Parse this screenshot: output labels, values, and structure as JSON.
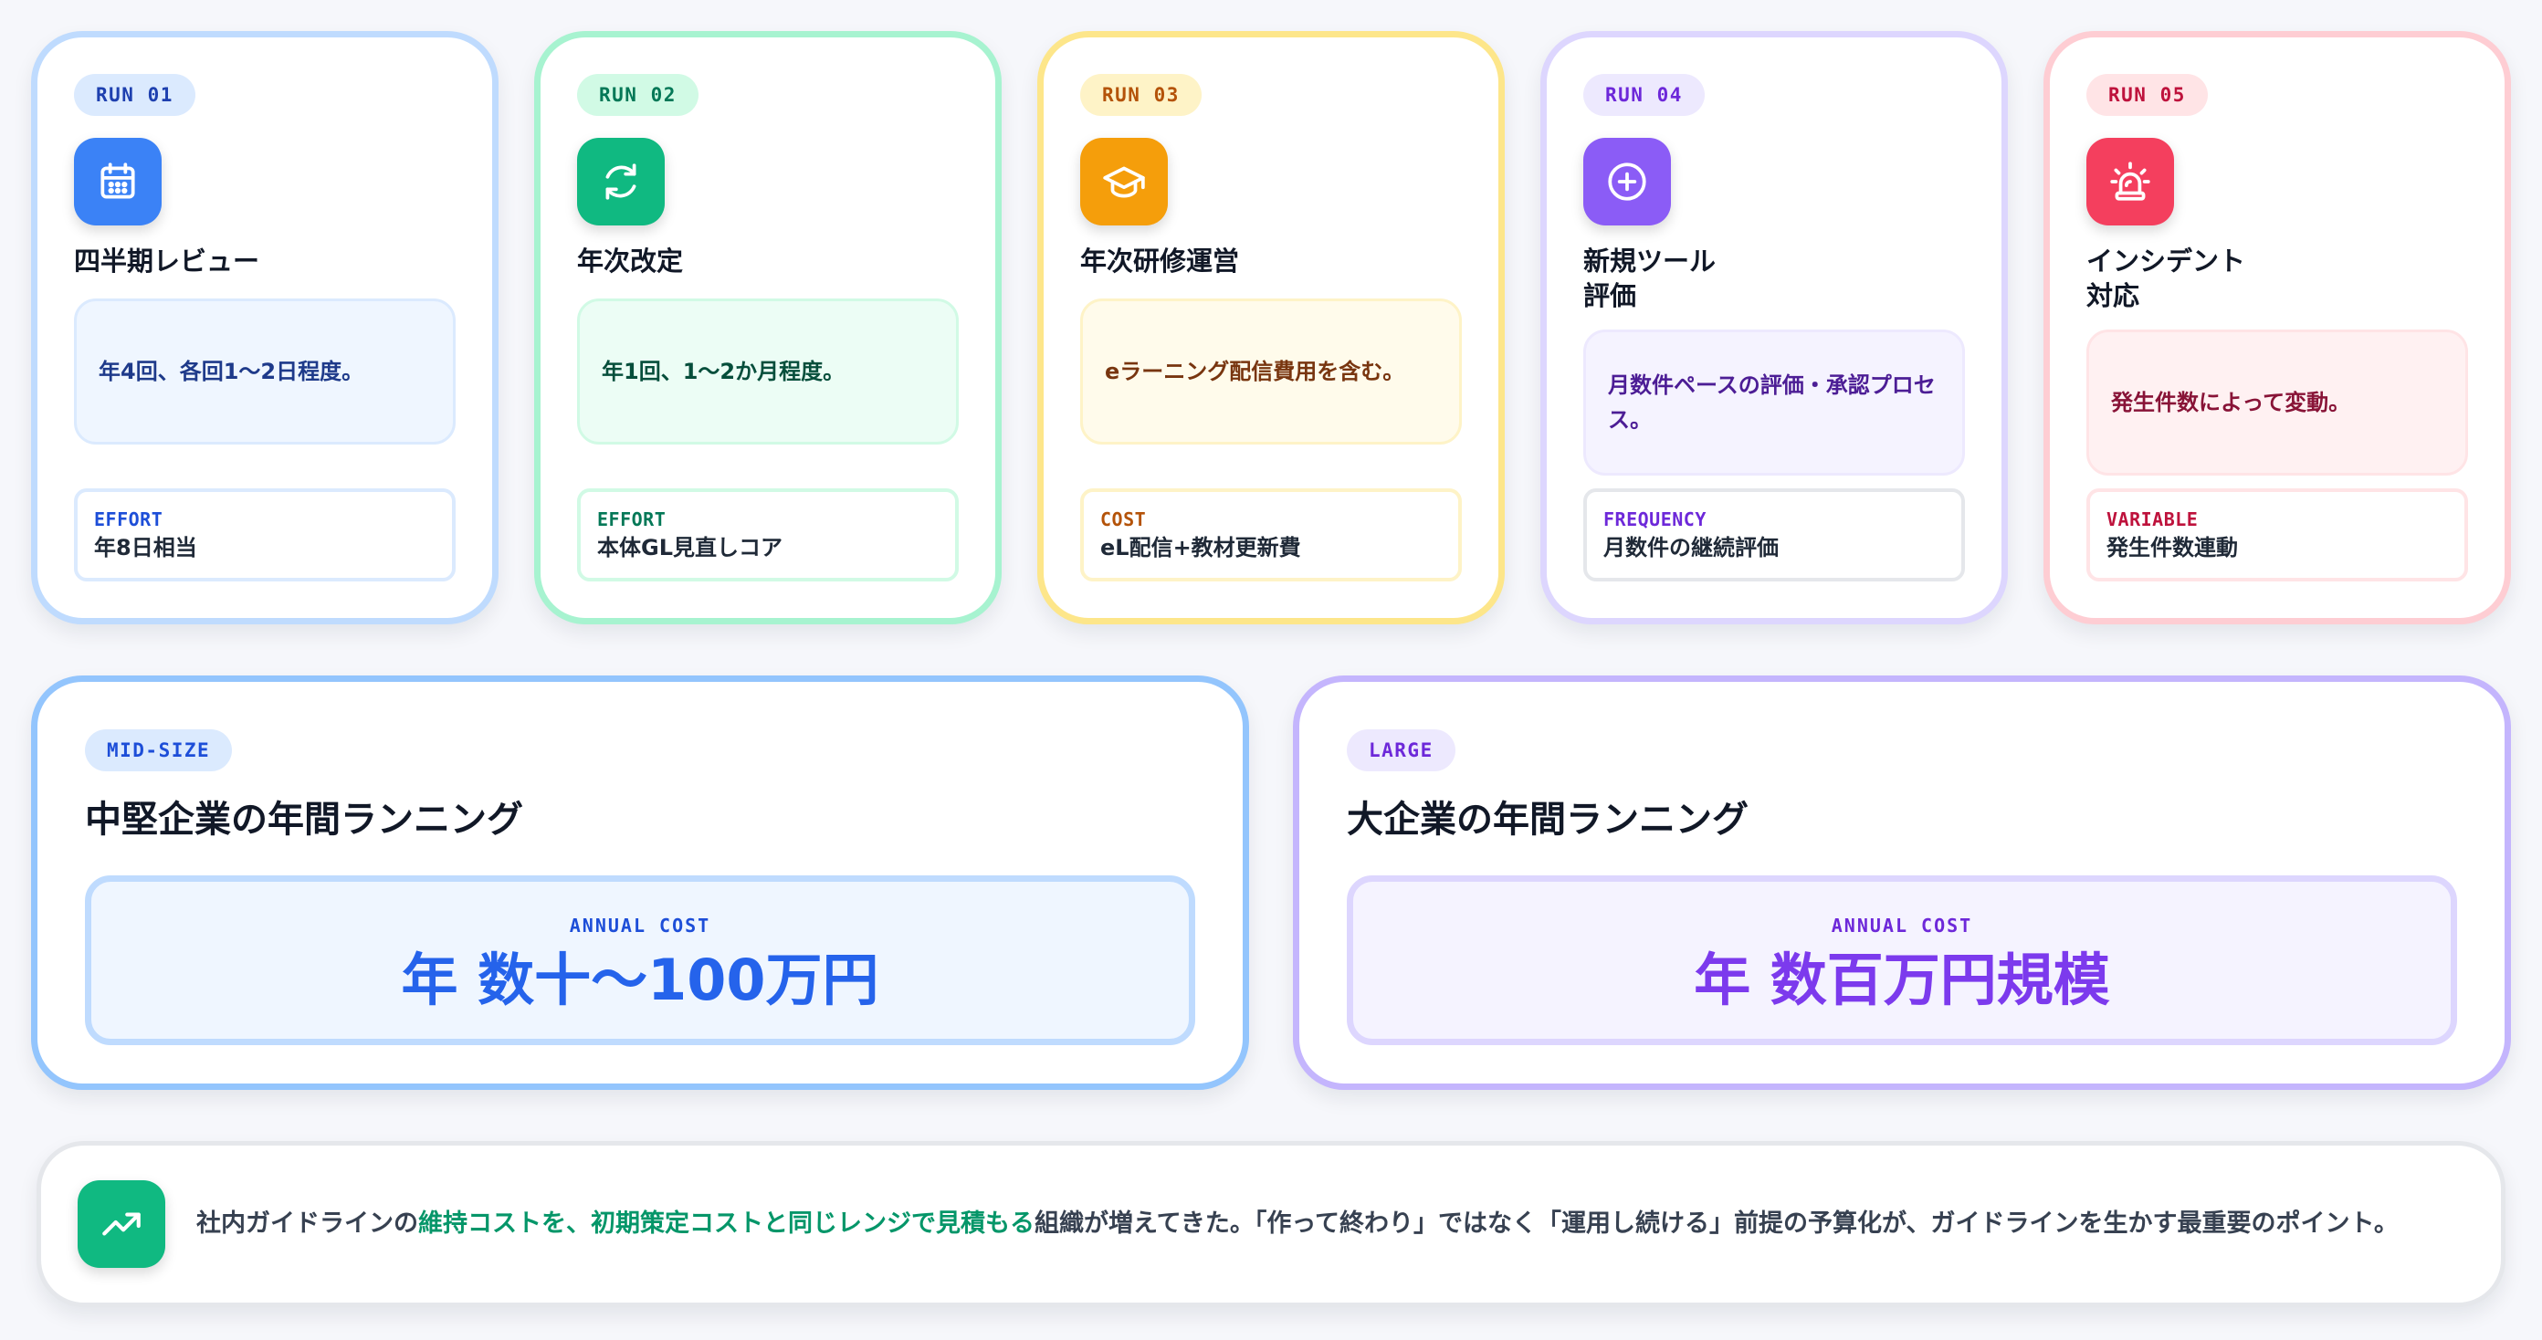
{
  "runs": [
    {
      "badge": "RUN 01",
      "icon": "calendar-icon",
      "title": "四半期レビュー",
      "desc": "年4回、各回1〜2日程度。",
      "meta_key": "EFFORT",
      "meta_value": "年8日相当",
      "colors": {
        "border": "#bfdbfe",
        "badge_bg": "#dbeafe",
        "badge_fg": "#1e40af",
        "icon_bg": "#3b82f6",
        "desc_bg": "#eff6ff",
        "desc_border": "#dbeafe",
        "desc_fg": "#1e3a8a",
        "meta_key_fg": "#1d4ed8",
        "meta_border": "#dbeafe"
      }
    },
    {
      "badge": "RUN 02",
      "icon": "refresh-icon",
      "title": "年次改定",
      "desc": "年1回、1〜2か月程度。",
      "meta_key": "EFFORT",
      "meta_value": "本体GL見直しコア",
      "colors": {
        "border": "#a7f3d0",
        "badge_bg": "#d1fae5",
        "badge_fg": "#047857",
        "icon_bg": "#10b981",
        "desc_bg": "#ecfdf5",
        "desc_border": "#d1fae5",
        "desc_fg": "#064e3b",
        "meta_key_fg": "#047857",
        "meta_border": "#d1fae5"
      }
    },
    {
      "badge": "RUN 03",
      "icon": "graduation-cap-icon",
      "title": "年次研修運営",
      "desc": "eラーニング配信費用を含む。",
      "meta_key": "COST",
      "meta_value": "eL配信+教材更新費",
      "colors": {
        "border": "#fde68a",
        "badge_bg": "#fef3c7",
        "badge_fg": "#b45309",
        "icon_bg": "#f59e0b",
        "desc_bg": "#fffbeb",
        "desc_border": "#fef3c7",
        "desc_fg": "#78350f",
        "meta_key_fg": "#b45309",
        "meta_border": "#fef3c7"
      }
    },
    {
      "badge": "RUN 04",
      "icon": "plus-circle-icon",
      "title": "新規ツール\n評価",
      "desc": "月数件ペースの評価・承認プロセス。",
      "meta_key": "FREQUENCY",
      "meta_value": "月数件の継続評価",
      "colors": {
        "border": "#ddd6fe",
        "badge_bg": "#ede9fe",
        "badge_fg": "#6d28d9",
        "icon_bg": "#8b5cf6",
        "desc_bg": "#f5f3ff",
        "desc_border": "#ede9fe",
        "desc_fg": "#4c1d95",
        "meta_key_fg": "#6d28d9",
        "meta_border": "#e5e7eb"
      }
    },
    {
      "badge": "RUN 05",
      "icon": "alarm-siren-icon",
      "title": "インシデント\n対応",
      "desc": "発生件数によって変動。",
      "meta_key": "VARIABLE",
      "meta_value": "発生件数連動",
      "colors": {
        "border": "#fecdd3",
        "badge_bg": "#ffe4e6",
        "badge_fg": "#be123c",
        "icon_bg": "#f43f5e",
        "desc_bg": "#fff1f2",
        "desc_border": "#ffe4e6",
        "desc_fg": "#881337",
        "meta_key_fg": "#be123c",
        "meta_border": "#ffe4e6"
      }
    }
  ],
  "mid": {
    "badge": "MID-SIZE",
    "title": "中堅企業の年間ランニング",
    "cost_label": "ANNUAL COST",
    "cost_value": "年 数十〜100万円",
    "colors": {
      "badge_bg": "#dbeafe",
      "badge_fg": "#1d4ed8",
      "cost_label_fg": "#1d4ed8",
      "cost_value_fg": "#2563eb"
    }
  },
  "large": {
    "badge": "LARGE",
    "title": "大企業の年間ランニング",
    "cost_label": "ANNUAL COST",
    "cost_value": "年 数百万円規模",
    "colors": {
      "badge_bg": "#ede9fe",
      "badge_fg": "#6d28d9",
      "cost_label_fg": "#6d28d9",
      "cost_value_fg": "#7c3aed"
    }
  },
  "note": {
    "icon": "trending-up-icon",
    "text_before": "社内ガイドラインの",
    "text_highlight": "維持コストを、初期策定コストと同じレンジで見積もる",
    "text_after": "組織が増えてきた。「作って終わり」ではなく「運用し続ける」前提の予算化が、ガイドラインを生かす最重要のポイント。"
  }
}
